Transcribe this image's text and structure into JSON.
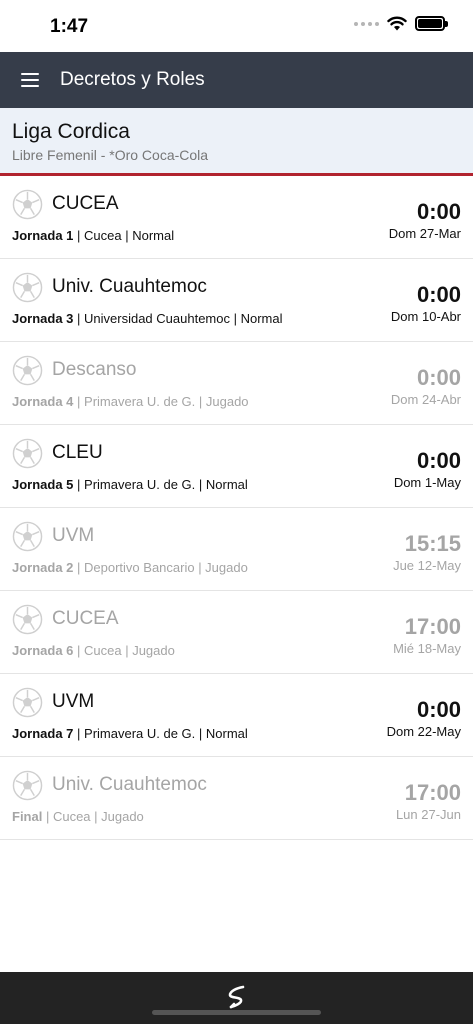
{
  "status_bar": {
    "time": "1:47"
  },
  "nav": {
    "title": "Decretos y Roles"
  },
  "league": {
    "name": "Liga Cordica",
    "category": "Libre Femenil - *Oro Coca-Cola"
  },
  "matches": [
    {
      "team": "CUCEA",
      "jornada": "Jornada 1",
      "details": " | Cucea | Normal",
      "time": "0:00",
      "date": "Dom 27-Mar",
      "status": "Normal"
    },
    {
      "team": "Univ. Cuauhtemoc",
      "jornada": "Jornada 3",
      "details": " | Universidad Cuauhtemoc | Normal",
      "time": "0:00",
      "date": "Dom 10-Abr",
      "status": "Normal"
    },
    {
      "team": "Descanso",
      "jornada": "Jornada 4",
      "details": " | Primavera U. de G. | Jugado",
      "time": "0:00",
      "date": "Dom 24-Abr",
      "status": "Jugado"
    },
    {
      "team": "CLEU",
      "jornada": "Jornada 5",
      "details": " | Primavera U. de G. | Normal",
      "time": "0:00",
      "date": "Dom 1-May",
      "status": "Normal"
    },
    {
      "team": "UVM",
      "jornada": "Jornada 2",
      "details": " | Deportivo Bancario | Jugado",
      "time": "15:15",
      "date": "Jue 12-May",
      "status": "Jugado"
    },
    {
      "team": "CUCEA",
      "jornada": "Jornada 6",
      "details": " | Cucea | Jugado",
      "time": "17:00",
      "date": "Mié 18-May",
      "status": "Jugado"
    },
    {
      "team": "UVM",
      "jornada": "Jornada 7",
      "details": " | Primavera U. de G. | Normal",
      "time": "0:00",
      "date": "Dom 22-May",
      "status": "Normal"
    },
    {
      "team": "Univ. Cuauhtemoc",
      "jornada": "Final",
      "details": " | Cucea | Jugado",
      "time": "17:00",
      "date": "Lun 27-Jun",
      "status": "Jugado"
    }
  ],
  "icons": {
    "menu": "hamburger-icon",
    "team": "soccer-ball-icon",
    "logo": "app-logo-icon"
  },
  "colors": {
    "nav_bg": "#363d4a",
    "header_bg": "#ecf1f8",
    "accent": "#b1232f",
    "played_text": "#a5a5a5"
  }
}
